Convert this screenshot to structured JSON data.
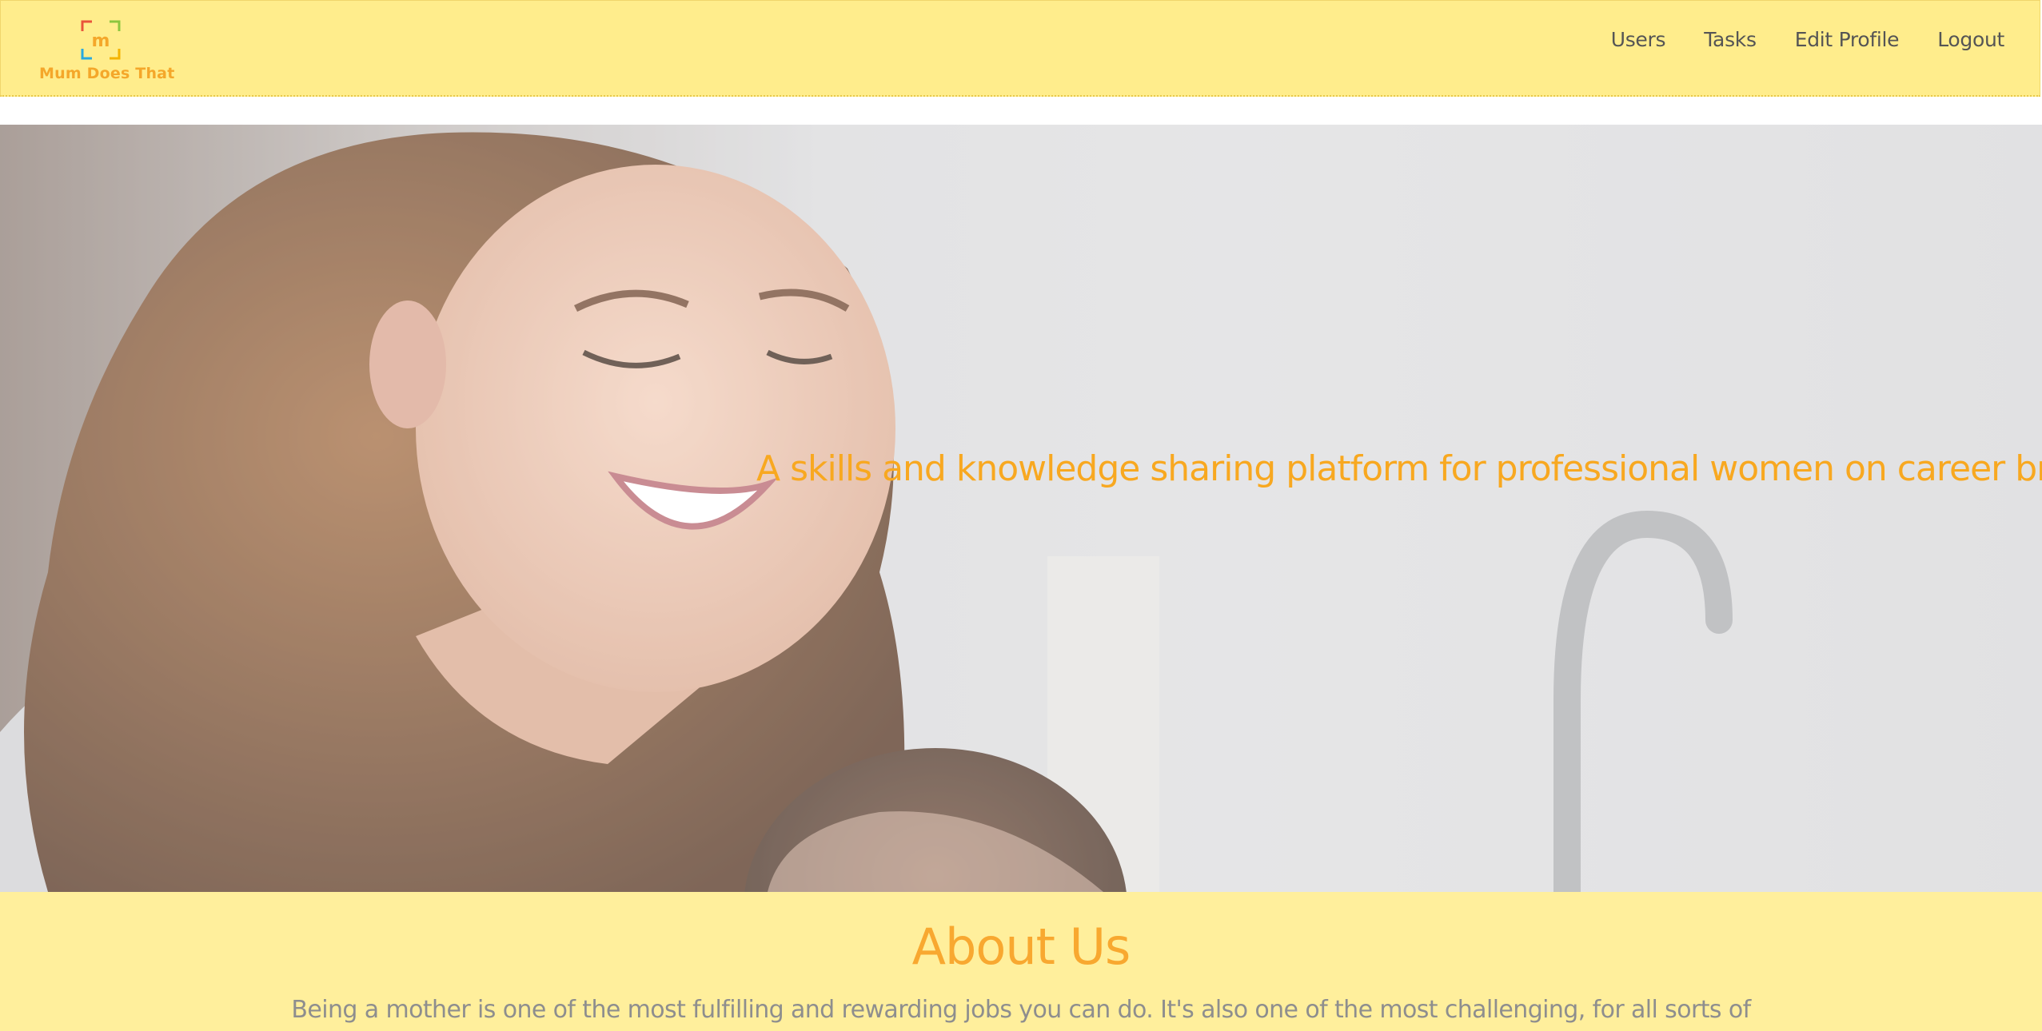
{
  "brand": {
    "name": "Mum Does That",
    "logo_letter": "m",
    "logo_icon": "framed-m-logo-icon"
  },
  "nav": {
    "items": [
      {
        "label": "Users"
      },
      {
        "label": "Tasks"
      },
      {
        "label": "Edit Profile"
      },
      {
        "label": "Logout"
      }
    ]
  },
  "hero": {
    "tagline": "A skills and knowledge sharing platform for professional women on career breaks",
    "image": "mother-holding-baby-photo"
  },
  "about": {
    "title": "About Us",
    "text": "Being a mother is one of the most fulfilling and rewarding jobs you can do. It's also one of the most challenging, for all sorts of reasons. Making the"
  },
  "colors": {
    "navbar_bg": "#ffed8c",
    "accent": "#f8a820",
    "nav_text": "#555555",
    "about_bg": "#ffef9c",
    "body_text": "#8e8e8e"
  }
}
